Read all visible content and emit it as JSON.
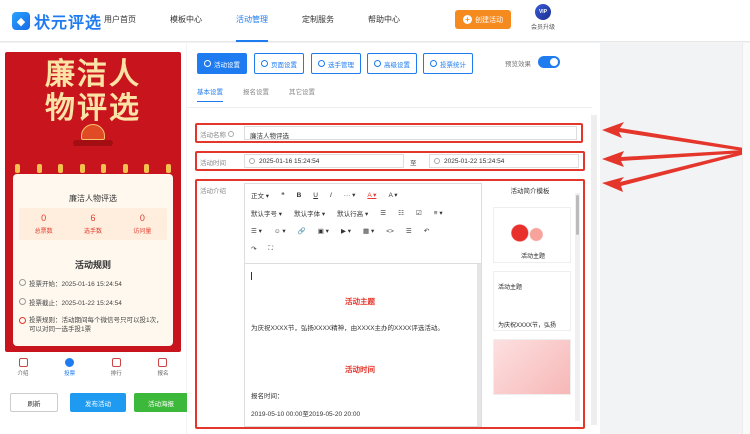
{
  "header": {
    "logo_text": "状元评选",
    "nav": [
      "用户首页",
      "模板中心",
      "活动管理",
      "定制服务",
      "帮助中心"
    ],
    "active_nav": "活动管理",
    "create_button": "创建活动",
    "vip_badge": "VIP",
    "vip_label": "会员升级"
  },
  "preview": {
    "poster_title_line1": "廉洁人",
    "poster_title_line2": "物评选",
    "card_title": "廉洁人物评选",
    "stats": [
      {
        "value": "0",
        "label": "总票数"
      },
      {
        "value": "6",
        "label": "选手数"
      },
      {
        "value": "0",
        "label": "访问量"
      }
    ],
    "rules_title": "活动规则",
    "rules": [
      "投票开始：2025-01-16 15:24:54",
      "投票截止：2025-01-22 15:24:54",
      "投票规则：活动期间每个微信号只可以投1次，可以对同一选手投1票"
    ],
    "tabbar": [
      "介绍",
      "投票",
      "排行",
      "报名"
    ],
    "buttons": {
      "refresh": "刷新",
      "publish": "发布活动",
      "poster": "活动海报"
    }
  },
  "settings": {
    "toolbar": [
      "活动设置",
      "页面设置",
      "选手管理",
      "高级设置",
      "投票统计"
    ],
    "preview_label": "预览效果",
    "subtabs": [
      "基本设置",
      "报名设置",
      "其它设置"
    ],
    "name_label": "活动名称",
    "name_value": "廉洁人物评选",
    "time_label": "活动时间",
    "start_time": "2025-01-16 15:24:54",
    "to_label": "至",
    "end_time": "2025-01-22 15:24:54",
    "intro_label": "活动介绍",
    "editor_toolbar_row1": [
      "正文",
      "❝",
      "B",
      "U",
      "I",
      "···",
      "A",
      "A"
    ],
    "editor_toolbar_row2": [
      "默认字号",
      "默认字体",
      "默认行高",
      "☰",
      "☷",
      "☑",
      "≡"
    ],
    "editor_toolbar_row3": [
      "☰",
      "☺",
      "🔗",
      "▣",
      "▶",
      "▦",
      "<>",
      "☰",
      "↶"
    ],
    "editor_toolbar_row4": [
      "↷",
      "⛶"
    ],
    "editor_heading1": "活动主题",
    "editor_paragraph1": "为庆祝XXXX节，弘扬XXXX精神，由XXXX主办的XXXX评选活动。",
    "editor_heading2": "活动时间",
    "editor_paragraph2": "报名时间：",
    "editor_paragraph3": "2019-05-10 00:00至2019-05-20 20:00",
    "templates_title": "活动简介模板",
    "template1_caption": "活动主题",
    "template2_title": "活动主题",
    "template2_text": "为庆祝XXXX节，弘扬"
  }
}
